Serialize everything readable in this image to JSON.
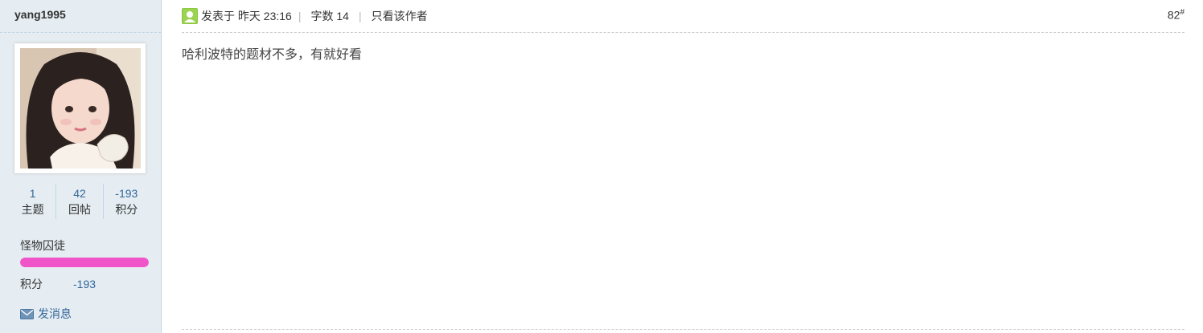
{
  "author": {
    "name": "yang1995",
    "stats": [
      {
        "value": "1",
        "label": "主题"
      },
      {
        "value": "42",
        "label": "回帖"
      },
      {
        "value": "-193",
        "label": "积分"
      }
    ],
    "rank_title": "怪物囚徒",
    "rank_progress": 1.0,
    "rank_bar_color": "#ef55c9",
    "credit_label": "积分",
    "credit_value": "-193",
    "send_message": "发消息"
  },
  "post": {
    "posted_label": "发表于",
    "posted_time": "昨天 23:16",
    "word_count_label": "字数",
    "word_count": "14",
    "only_author": "只看该作者",
    "floor_number": "82",
    "floor_suffix": "#",
    "content": "哈利波特的题材不多，有就好看"
  },
  "icons": {
    "online": "online-user-icon",
    "message": "envelope-icon"
  },
  "colors": {
    "link": "#336699",
    "sidebar_bg": "#e5edf2"
  }
}
